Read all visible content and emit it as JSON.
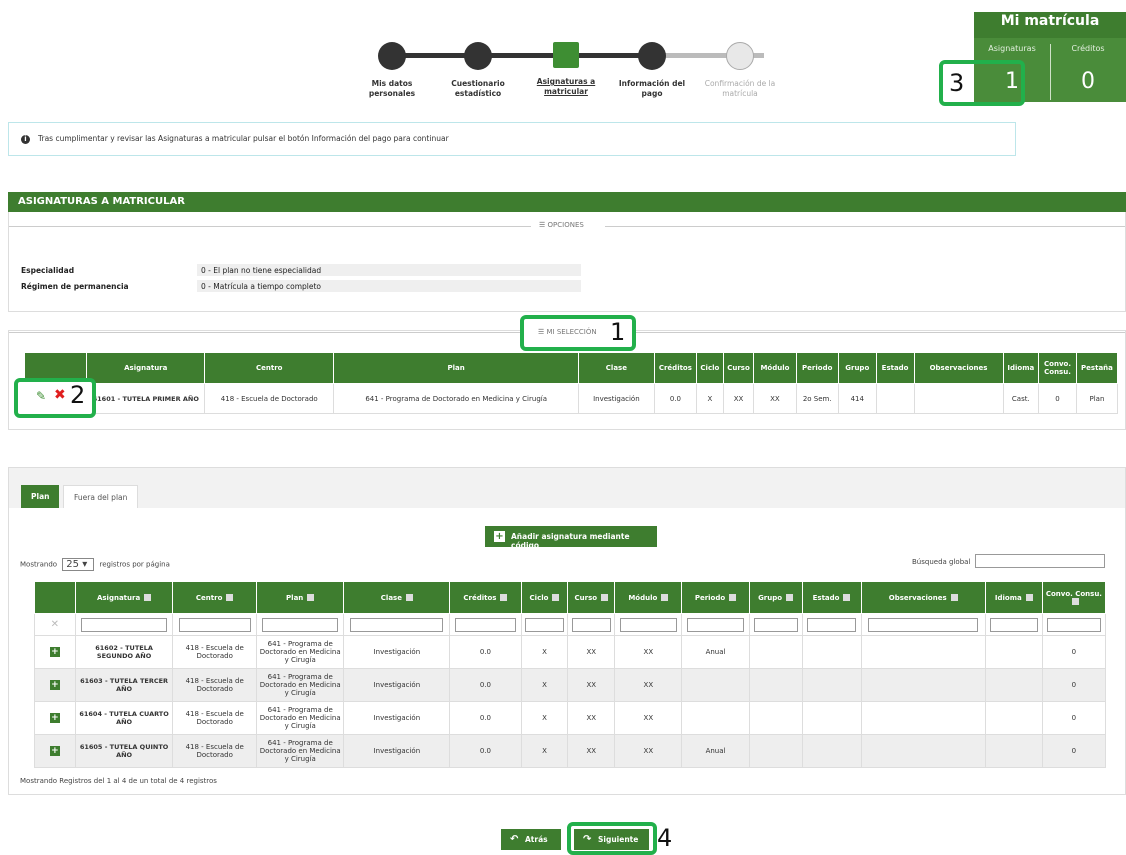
{
  "stepper": {
    "steps": [
      {
        "label": "Mis datos personales"
      },
      {
        "label": "Cuestionario estadístico"
      },
      {
        "label": "Asignaturas a matricular"
      },
      {
        "label": "Información del pago"
      },
      {
        "label": "Confirmación de la matrícula"
      }
    ]
  },
  "mi_matricula": {
    "title": "Mi matrícula",
    "asignaturas_label": "Asignaturas",
    "asignaturas_value": "1",
    "creditos_label": "Créditos",
    "creditos_value": "0"
  },
  "info": {
    "text": "Tras cumplimentar y revisar las Asignaturas a matricular pulsar el botón Información del pago para continuar"
  },
  "section": {
    "title": "ASIGNATURAS A MATRICULAR",
    "opciones_label": "OPCIONES",
    "especialidad_label": "Especialidad",
    "especialidad_value": "0 - El plan no tiene especialidad",
    "regimen_label": "Régimen de permanencia",
    "regimen_value": "0 - Matrícula a tiempo completo",
    "seleccion_label": "MI SELECCIÓN"
  },
  "selection_table": {
    "headers": [
      "",
      "Asignatura",
      "Centro",
      "Plan",
      "Clase",
      "Créditos",
      "Ciclo",
      "Curso",
      "Módulo",
      "Periodo",
      "Grupo",
      "Estado",
      "Observaciones",
      "Idioma",
      "Convo. Consu.",
      "Pestaña"
    ],
    "row": {
      "asignatura": "61601 - TUTELA PRIMER AÑO",
      "centro": "418 - Escuela de Doctorado",
      "plan": "641 - Programa de Doctorado en Medicina y Cirugía",
      "clase": "Investigación",
      "creditos": "0.0",
      "ciclo": "X",
      "curso": "XX",
      "modulo": "XX",
      "periodo": "2o Sem.",
      "grupo": "414",
      "estado": "",
      "observaciones": "",
      "idioma": "Cast.",
      "convo": "0",
      "pestana": "Plan"
    }
  },
  "tabs": [
    {
      "label": "Plan"
    },
    {
      "label": "Fuera del plan"
    }
  ],
  "add_button": {
    "label": "Añadir asignatura mediante código"
  },
  "listing": {
    "showing_prefix": "Mostrando",
    "page_size": "25",
    "showing_suffix": "registros por página",
    "global_search_label": "Búsqueda global",
    "footer": "Mostrando Registros del 1 al 4 de un total de 4 registros"
  },
  "main_table": {
    "headers": [
      "",
      "Asignatura",
      "Centro",
      "Plan",
      "Clase",
      "Créditos",
      "Ciclo",
      "Curso",
      "Módulo",
      "Periodo",
      "Grupo",
      "Estado",
      "Observaciones",
      "Idioma",
      "Convo. Consu."
    ],
    "rows": [
      {
        "asignatura": "61602 - TUTELA SEGUNDO AÑO",
        "centro": "418 - Escuela de Doctorado",
        "plan": "641 - Programa de Doctorado en Medicina y Cirugía",
        "clase": "Investigación",
        "creditos": "0.0",
        "ciclo": "X",
        "curso": "XX",
        "modulo": "XX",
        "periodo": "Anual",
        "grupo": "",
        "estado": "",
        "observaciones": "",
        "idioma": "",
        "convo": "0"
      },
      {
        "asignatura": "61603 - TUTELA TERCER AÑO",
        "centro": "418 - Escuela de Doctorado",
        "plan": "641 - Programa de Doctorado en Medicina y Cirugía",
        "clase": "Investigación",
        "creditos": "0.0",
        "ciclo": "X",
        "curso": "XX",
        "modulo": "XX",
        "periodo": "",
        "grupo": "",
        "estado": "",
        "observaciones": "",
        "idioma": "",
        "convo": "0"
      },
      {
        "asignatura": "61604 - TUTELA CUARTO AÑO",
        "centro": "418 - Escuela de Doctorado",
        "plan": "641 - Programa de Doctorado en Medicina y Cirugía",
        "clase": "Investigación",
        "creditos": "0.0",
        "ciclo": "X",
        "curso": "XX",
        "modulo": "XX",
        "periodo": "",
        "grupo": "",
        "estado": "",
        "observaciones": "",
        "idioma": "",
        "convo": "0"
      },
      {
        "asignatura": "61605 - TUTELA QUINTO AÑO",
        "centro": "418 - Escuela de Doctorado",
        "plan": "641 - Programa de Doctorado en Medicina y Cirugía",
        "clase": "Investigación",
        "creditos": "0.0",
        "ciclo": "X",
        "curso": "XX",
        "modulo": "XX",
        "periodo": "Anual",
        "grupo": "",
        "estado": "",
        "observaciones": "",
        "idioma": "",
        "convo": "0"
      }
    ]
  },
  "nav": {
    "back_label": "Atrás",
    "next_label": "Siguiente"
  },
  "annotations": {
    "n1": "1",
    "n2": "2",
    "n3": "3",
    "n4": "4"
  },
  "colors": {
    "brand_green": "#3e7d2f",
    "callout_green": "#22b04b"
  }
}
